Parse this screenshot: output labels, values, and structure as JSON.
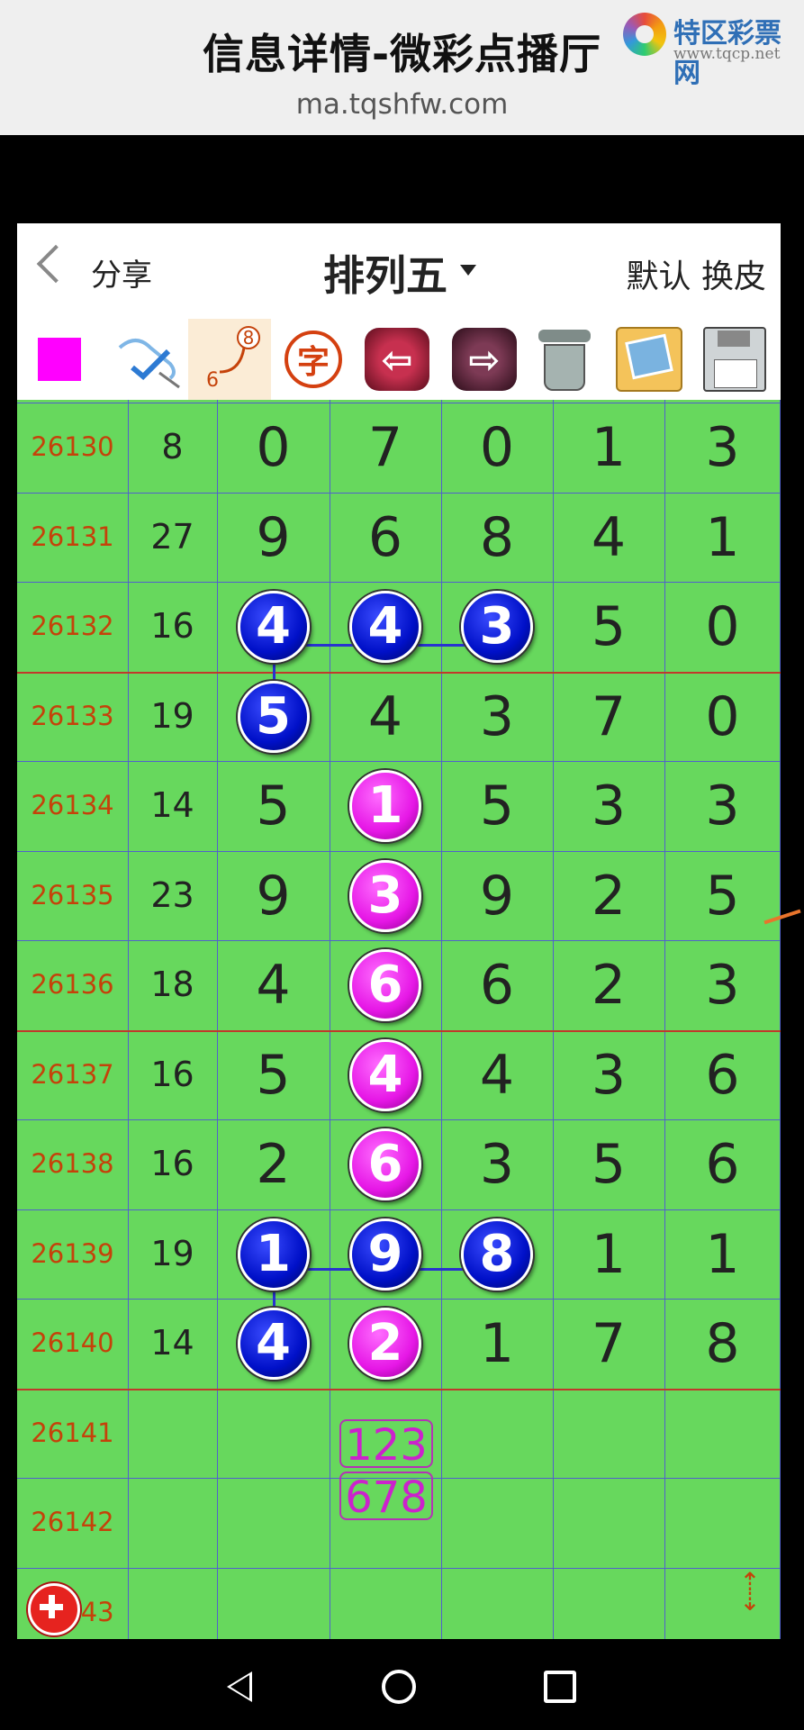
{
  "header": {
    "title": "信息详情-微彩点播厅",
    "url": "ma.tqshfw.com",
    "logo_name": "特区彩票网",
    "logo_url": "www.tqcp.net"
  },
  "nav": {
    "back_icon": "chevron-left-icon",
    "share_label": "分享",
    "title": "排列五",
    "default_label": "默认",
    "skin_label": "换皮"
  },
  "toolbar": {
    "items": [
      "magenta-square",
      "brush-check-icon",
      "line-68-icon",
      "字",
      "arrow-left-icon",
      "arrow-right-icon",
      "trash-icon",
      "photo-icon",
      "save-disk-icon"
    ],
    "line_top_digit": "8",
    "line_bottom_digit": "6",
    "zi_label": "字"
  },
  "grid": {
    "rows": [
      {
        "issue": "26130",
        "sum": "8",
        "digits": [
          "0",
          "7",
          "0",
          "1",
          "3"
        ]
      },
      {
        "issue": "26131",
        "sum": "27",
        "digits": [
          "9",
          "6",
          "8",
          "4",
          "1"
        ]
      },
      {
        "issue": "26132",
        "sum": "16",
        "digits": [
          "4",
          "4",
          "3",
          "5",
          "0"
        ]
      },
      {
        "issue": "26133",
        "sum": "19",
        "digits": [
          "5",
          "4",
          "3",
          "7",
          "0"
        ]
      },
      {
        "issue": "26134",
        "sum": "14",
        "digits": [
          "5",
          "1",
          "5",
          "3",
          "3"
        ]
      },
      {
        "issue": "26135",
        "sum": "23",
        "digits": [
          "9",
          "3",
          "9",
          "2",
          "5"
        ]
      },
      {
        "issue": "26136",
        "sum": "18",
        "digits": [
          "4",
          "6",
          "6",
          "2",
          "3"
        ]
      },
      {
        "issue": "26137",
        "sum": "16",
        "digits": [
          "5",
          "4",
          "4",
          "3",
          "6"
        ]
      },
      {
        "issue": "26138",
        "sum": "16",
        "digits": [
          "2",
          "6",
          "3",
          "5",
          "6"
        ]
      },
      {
        "issue": "26139",
        "sum": "19",
        "digits": [
          "1",
          "9",
          "8",
          "1",
          "1"
        ]
      },
      {
        "issue": "26140",
        "sum": "14",
        "digits": [
          "4",
          "2",
          "1",
          "7",
          "8"
        ]
      },
      {
        "issue": "26141",
        "sum": "",
        "digits": [
          "",
          "",
          "",
          "",
          ""
        ]
      },
      {
        "issue": "26142",
        "sum": "",
        "digits": [
          "",
          "",
          "",
          "",
          ""
        ]
      },
      {
        "issue": "26143",
        "sum": "",
        "digits": [
          "",
          "",
          "",
          "",
          ""
        ]
      }
    ],
    "prediction": [
      "123",
      "678"
    ],
    "colors": {
      "grid_bg": "#67d85d",
      "issue": "#c5420a",
      "blue_ball": "#0010c8",
      "pink_ball": "#e617e6"
    }
  },
  "fab": {
    "plus_icon": "plus-icon",
    "updown_icon": "up-down-arrows-icon"
  },
  "system_nav": [
    "back-icon",
    "home-icon",
    "recents-icon"
  ]
}
